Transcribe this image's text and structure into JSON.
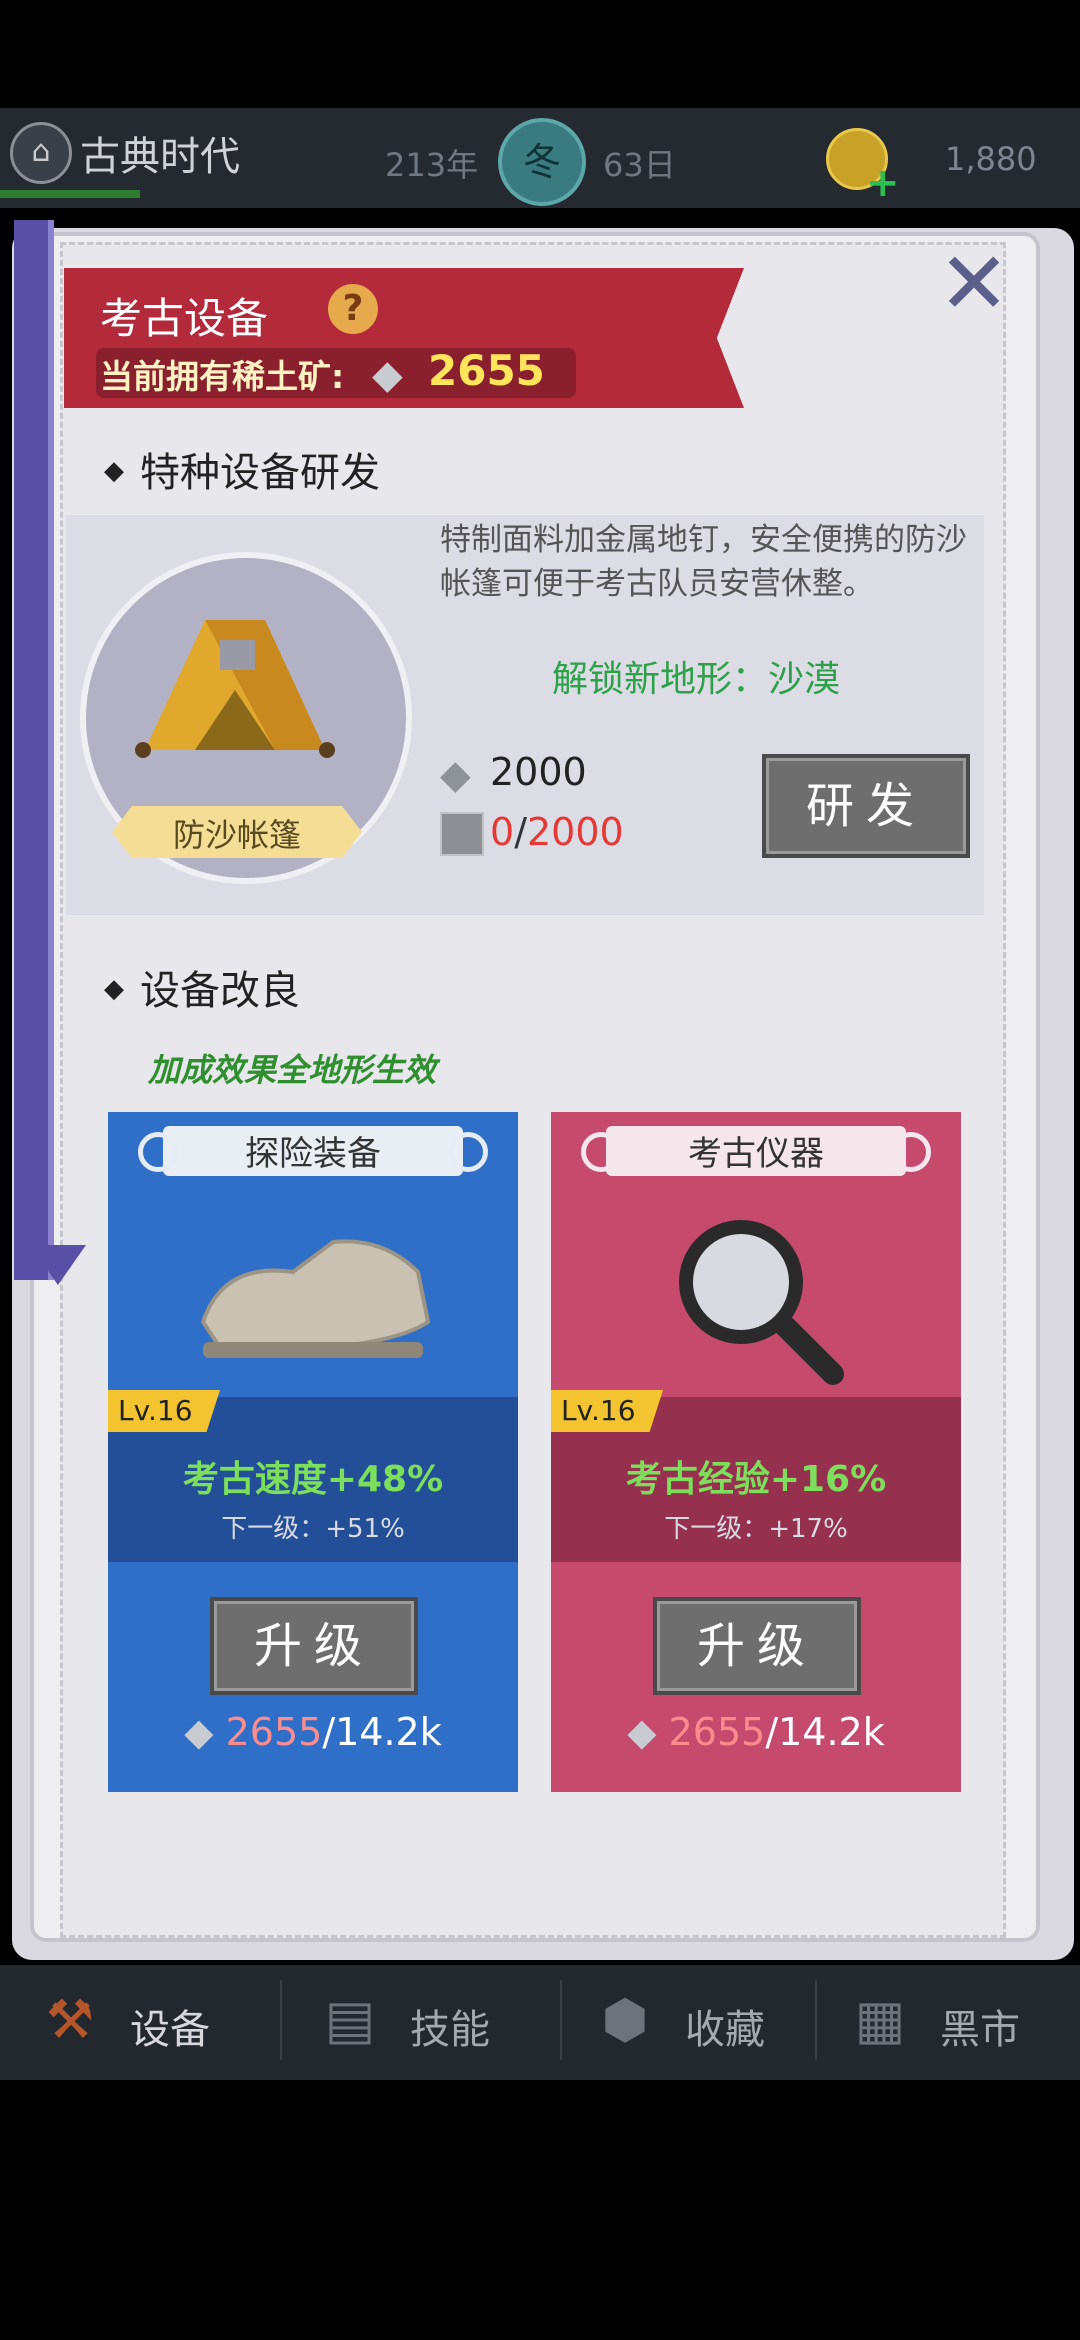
{
  "topbar": {
    "era_name": "古典时代",
    "year": "213年",
    "season": "冬",
    "day": "63日",
    "coins": "1,880"
  },
  "panel": {
    "title": "考古设备",
    "help": "?",
    "owned_label": "当前拥有稀土矿:",
    "owned_value": "2655",
    "close": "✕"
  },
  "special_dev": {
    "heading": "特种设备研发",
    "item_name": "防沙帐篷",
    "description": "特制面料加金属地钉，安全便携的防沙帐篷可便于考古队员安营休整。",
    "unlock": "解锁新地形：沙漠",
    "cost_ore": "2000",
    "cost_block_have": "0",
    "cost_block_sep": "/",
    "cost_block_need": "2000",
    "button": "研发"
  },
  "improve": {
    "heading": "设备改良",
    "note": "加成效果全地形生效",
    "cards": [
      {
        "title": "探险装备",
        "level": "Lv.16",
        "effect": "考古速度+48%",
        "next": "下一级：+51%",
        "button": "升级",
        "cost_have": "2655",
        "cost_need": "/14.2k"
      },
      {
        "title": "考古仪器",
        "level": "Lv.16",
        "effect": "考古经验+16%",
        "next": "下一级：+17%",
        "button": "升级",
        "cost_have": "2655",
        "cost_need": "/14.2k"
      }
    ]
  },
  "bottom_nav": [
    {
      "label": "设备",
      "icon": "anvil-icon"
    },
    {
      "label": "技能",
      "icon": "skill-book-icon"
    },
    {
      "label": "收藏",
      "icon": "collection-icon"
    },
    {
      "label": "黑市",
      "icon": "market-icon"
    }
  ],
  "colors": {
    "banner": "#b32b3b",
    "card_blue": "#2f6fc8",
    "card_pink": "#c54a6e",
    "effect_green": "#7dde5c",
    "cost_red": "#e53935"
  }
}
